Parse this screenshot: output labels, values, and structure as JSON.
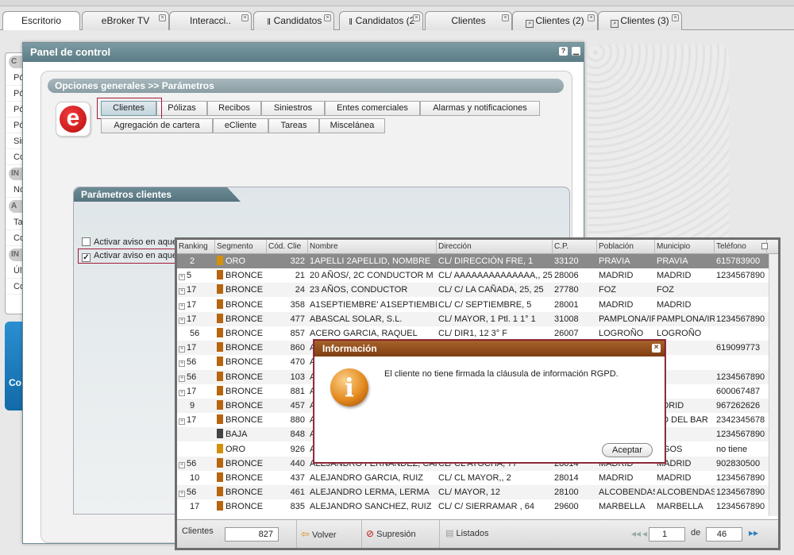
{
  "tabs": [
    {
      "label": "Escritorio",
      "active": true
    },
    {
      "label": "eBroker TV"
    },
    {
      "label": "Interacci.."
    },
    {
      "label": "Candidatos"
    },
    {
      "label": "Candidatos (2"
    },
    {
      "label": "Clientes"
    },
    {
      "label": "Clientes (2)"
    },
    {
      "label": "Clientes (3)"
    }
  ],
  "sidebar": {
    "items": [
      "Pó",
      "Pó",
      "Pó",
      "Pó",
      "Sin",
      "Co",
      "No",
      "Ta",
      "Co",
      "Últ",
      "Co"
    ],
    "headers": [
      "C",
      "IN",
      "A",
      "IN"
    ],
    "logo_text": "Co"
  },
  "panel": {
    "title": "Panel de control",
    "help": "?",
    "breadcrumb": "Opciones generales >> Parámetros",
    "logo_letter": "e",
    "tabs_row1": [
      "Clientes",
      "Pólizas",
      "Recibos",
      "Siniestros",
      "Entes comerciales",
      "Alarmas y notificaciones"
    ],
    "tabs_row2": [
      "Agregación de cartera",
      "eCliente",
      "Tareas",
      "Miscelánea"
    ],
    "section_title": "Parámetros clientes",
    "options": [
      {
        "label": "Activar aviso en aquellos clientes que no tengan firmada la cláusula de información previa.",
        "checked": false
      },
      {
        "label": "Activar aviso en aquellos clientes que no tengan firmada la cláusula RGPD.",
        "checked": true
      }
    ]
  },
  "grid": {
    "columns": [
      "Ranking",
      "Segmento",
      "Cód. Clie",
      "Nombre",
      "Dirección",
      "C.P.",
      "Población",
      "Municipio",
      "Teléfono"
    ],
    "rows": [
      {
        "rank": "2",
        "seg": "ORO",
        "segcolor": "#d4900a",
        "code": "322",
        "name": "1APELLI 2APELLID, NOMBRE",
        "dir": "CL/ DIRECCIÓN FRE, 1",
        "cp": "33120",
        "pob": "PRAVIA",
        "mun": "PRAVIA",
        "tel": "615783900",
        "exp": false,
        "selected": true
      },
      {
        "rank": "5",
        "seg": "BRONCE",
        "segcolor": "#b8650f",
        "code": "21",
        "name": "20 AÑOS/, 2C CONDUCTOR M",
        "dir": "CL/ AAAAAAAAAAAAAA,, 25 ,",
        "cp": "28006",
        "pob": "MADRID",
        "mun": "MADRID",
        "tel": "1234567890",
        "exp": true
      },
      {
        "rank": "17",
        "seg": "BRONCE",
        "segcolor": "#b8650f",
        "code": "24",
        "name": "23 AÑOS, CONDUCTOR",
        "dir": "CL/ C/ LA CAÑADA, 25, 25",
        "cp": "27780",
        "pob": "FOZ",
        "mun": "FOZ",
        "tel": "",
        "exp": true
      },
      {
        "rank": "17",
        "seg": "BRONCE",
        "segcolor": "#b8650f",
        "code": "358",
        "name": "A1SEPTIEMBRE' A1SEPTIEMBRE, N",
        "dir": "CL/ C/ SEPTIEMBRE, 5",
        "cp": "28001",
        "pob": "MADRID",
        "mun": "MADRID",
        "tel": "",
        "exp": true
      },
      {
        "rank": "17",
        "seg": "BRONCE",
        "segcolor": "#b8650f",
        "code": "477",
        "name": "ABASCAL SOLAR, S.L.",
        "dir": "CL/ MAYOR, 1 Ptl. 1 1° 1",
        "cp": "31008",
        "pob": "PAMPLONA/IRUÑ",
        "mun": "PAMPLONA/IRU",
        "tel": "1234567890",
        "exp": true
      },
      {
        "rank": "56",
        "seg": "BRONCE",
        "segcolor": "#b8650f",
        "code": "857",
        "name": "ACERO GARCIA, RAQUEL",
        "dir": "CL/ DIR1, 12 3° F",
        "cp": "26007",
        "pob": "LOGROÑO",
        "mun": "LOGROÑO",
        "tel": "",
        "exp": false
      },
      {
        "rank": "17",
        "seg": "BRONCE",
        "segcolor": "#b8650f",
        "code": "860",
        "name": "A",
        "dir": "",
        "cp": "",
        "pob": "",
        "mun": "",
        "tel": "619099773",
        "exp": true
      },
      {
        "rank": "56",
        "seg": "BRONCE",
        "segcolor": "#b8650f",
        "code": "470",
        "name": "A",
        "dir": "",
        "cp": "",
        "pob": "",
        "mun": "",
        "tel": "",
        "exp": true
      },
      {
        "rank": "56",
        "seg": "BRONCE",
        "segcolor": "#b8650f",
        "code": "103",
        "name": "A",
        "dir": "",
        "cp": "",
        "pob": "",
        "mun": "Z",
        "tel": "1234567890",
        "exp": true
      },
      {
        "rank": "17",
        "seg": "BRONCE",
        "segcolor": "#b8650f",
        "code": "881",
        "name": "A",
        "dir": "",
        "cp": "",
        "pob": "",
        "mun": "",
        "tel": "600067487",
        "exp": true
      },
      {
        "rank": "9",
        "seg": "BRONCE",
        "segcolor": "#b8650f",
        "code": "457",
        "name": "A",
        "dir": "",
        "cp": "",
        "pob": "",
        "mun": "ADRID",
        "tel": "967262626",
        "exp": false
      },
      {
        "rank": "17",
        "seg": "BRONCE",
        "segcolor": "#b8650f",
        "code": "880",
        "name": "A",
        "dir": "",
        "cp": "",
        "pob": "",
        "mun": "TO DEL BAR",
        "tel": "2342345678",
        "exp": true
      },
      {
        "rank": "",
        "seg": "BAJA",
        "segcolor": "#444444",
        "code": "848",
        "name": "A",
        "dir": "",
        "cp": "",
        "pob": "",
        "mun": "",
        "tel": "1234567890",
        "exp": false
      },
      {
        "rank": "",
        "seg": "ORO",
        "segcolor": "#d4900a",
        "code": "926",
        "name": "A",
        "dir": "",
        "cp": "",
        "pob": "",
        "mun": "RGOS",
        "tel": "no tiene",
        "exp": false
      },
      {
        "rank": "56",
        "seg": "BRONCE",
        "segcolor": "#b8650f",
        "code": "440",
        "name": "ALEJANDRO FERNANDEZ, CARLO",
        "dir": "CL/ CL ATOCHA, 77",
        "cp": "28014",
        "pob": "MADRID",
        "mun": "MADRID",
        "tel": "902830500",
        "exp": true
      },
      {
        "rank": "10",
        "seg": "BRONCE",
        "segcolor": "#b8650f",
        "code": "437",
        "name": "ALEJANDRO GARCIA, RUIZ",
        "dir": "CL/ CL MAYOR,, 2",
        "cp": "28014",
        "pob": "MADRID",
        "mun": "MADRID",
        "tel": "1234567890",
        "exp": false
      },
      {
        "rank": "56",
        "seg": "BRONCE",
        "segcolor": "#b8650f",
        "code": "461",
        "name": "ALEJANDRO LERMA, LERMA",
        "dir": "CL/ MAYOR, 12",
        "cp": "28100",
        "pob": "ALCOBENDAS",
        "mun": "ALCOBENDAS",
        "tel": "1234567890",
        "exp": true
      },
      {
        "rank": "17",
        "seg": "BRONCE",
        "segcolor": "#b8650f",
        "code": "835",
        "name": "ALEJANDRO SANCHEZ, RUIZ",
        "dir": "CL/ C/ SIERRAMAR , 64",
        "cp": "29600",
        "pob": "MARBELLA",
        "mun": "MARBELLA",
        "tel": "1234567890",
        "exp": false
      }
    ],
    "footer": {
      "clientes_label": "Clientes",
      "clientes_count": "827",
      "volver": "Volver",
      "supresion": "Supresión",
      "listados": "Listados",
      "page": "1",
      "de": "de",
      "total_pages": "46"
    }
  },
  "dialog": {
    "title": "Información",
    "message": "El cliente no tiene firmada la cláusula de información RGPD.",
    "ok": "Aceptar",
    "icon_letter": "i"
  }
}
